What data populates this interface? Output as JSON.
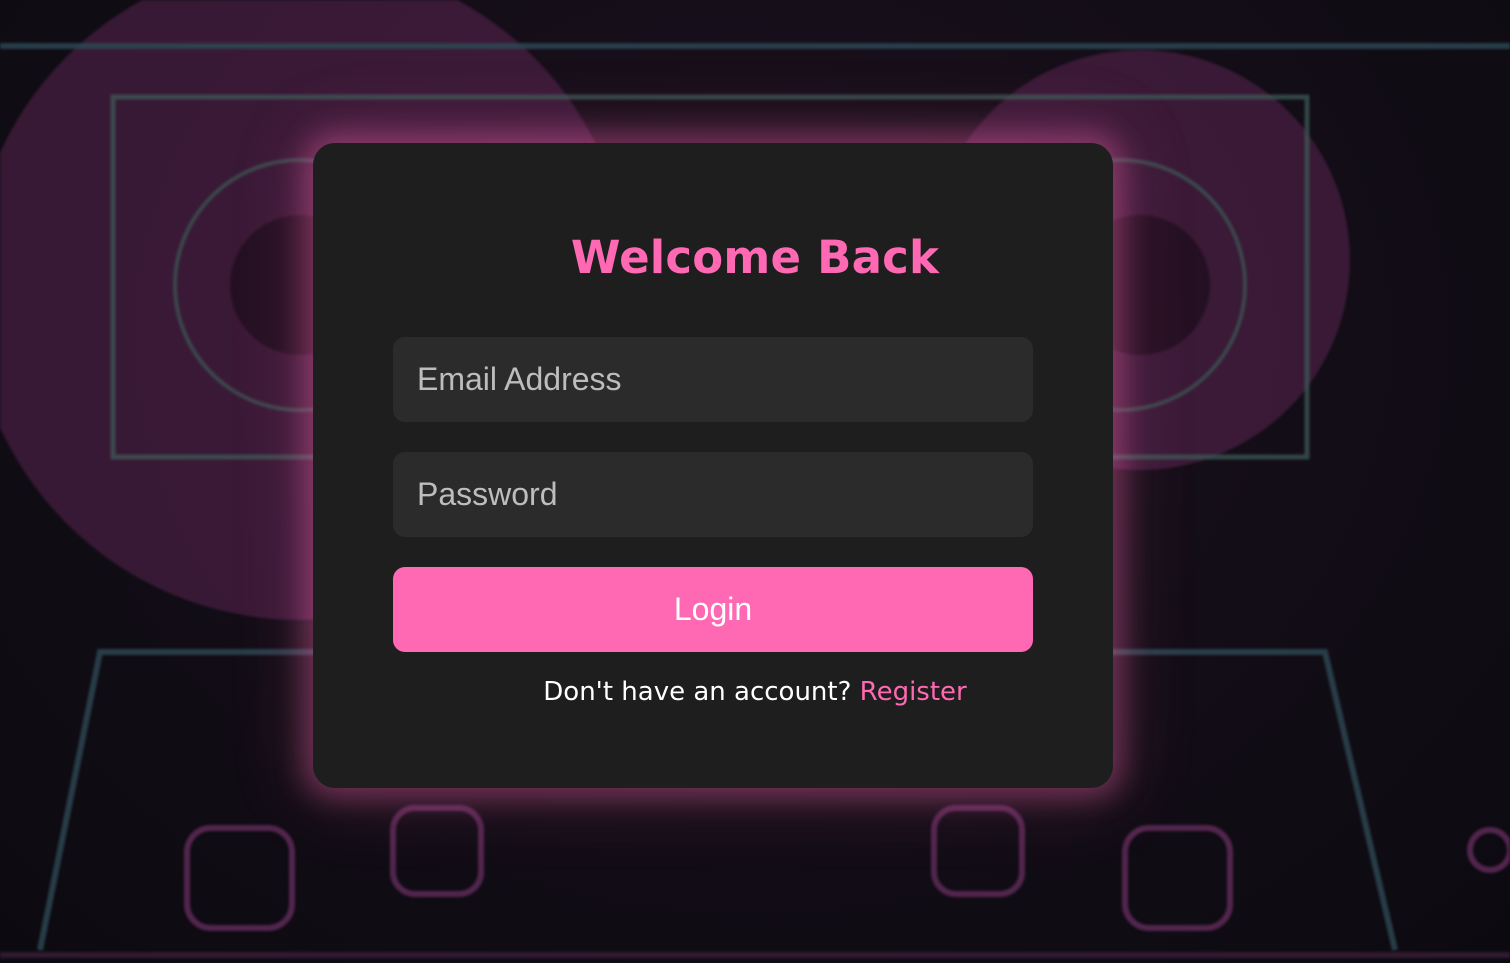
{
  "theme": {
    "accent": "#ff69b4",
    "card_background": "#1e1e1e",
    "input_background": "#2b2b2b",
    "page_background": "#0f0c14"
  },
  "login_form": {
    "title": "Welcome Back",
    "email_placeholder": "Email Address",
    "email_value": "",
    "password_placeholder": "Password",
    "password_value": "",
    "login_button_label": "Login",
    "register_prompt": "Don't have an account?",
    "register_link_label": "Register"
  },
  "background": {
    "decoration": "cassette-tape-icon"
  }
}
